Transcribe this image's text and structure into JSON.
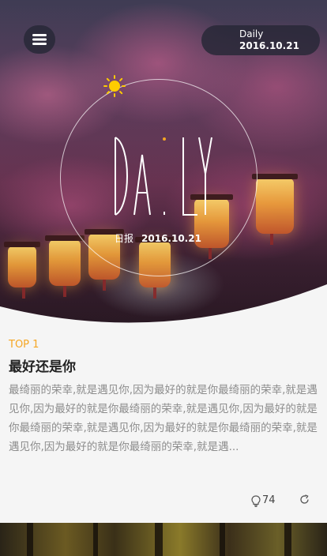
{
  "header": {
    "menu_icon": "hamburger-menu-icon",
    "date_pill": {
      "title": "Daily",
      "date": "2016.10.21"
    }
  },
  "hero": {
    "logo_text": "DAILY",
    "sun_icon": "sun-icon",
    "dateline_cn": "日报",
    "dateline_date": "2016.10.21"
  },
  "article": {
    "badge": "TOP 1",
    "title": "最好还是你",
    "excerpt": "最绮丽的荣幸,就是遇见你,因为最好的就是你最绮丽的荣幸,就是遇见你,因为最好的就是你最绮丽的荣幸,就是遇见你,因为最好的就是你最绮丽的荣幸,就是遇见你,因为最好的就是你最绮丽的荣幸,就是遇见你,因为最好的就是你最绮丽的荣幸,就是遇...",
    "likes": "74",
    "like_icon": "lightbulb-icon",
    "share_icon": "share-icon"
  },
  "colors": {
    "accent": "#f5a623",
    "title": "#222222",
    "excerpt": "#8c8c8c",
    "card_bg": "#f5f5f5",
    "pill_bg": "#2b2b3a"
  }
}
